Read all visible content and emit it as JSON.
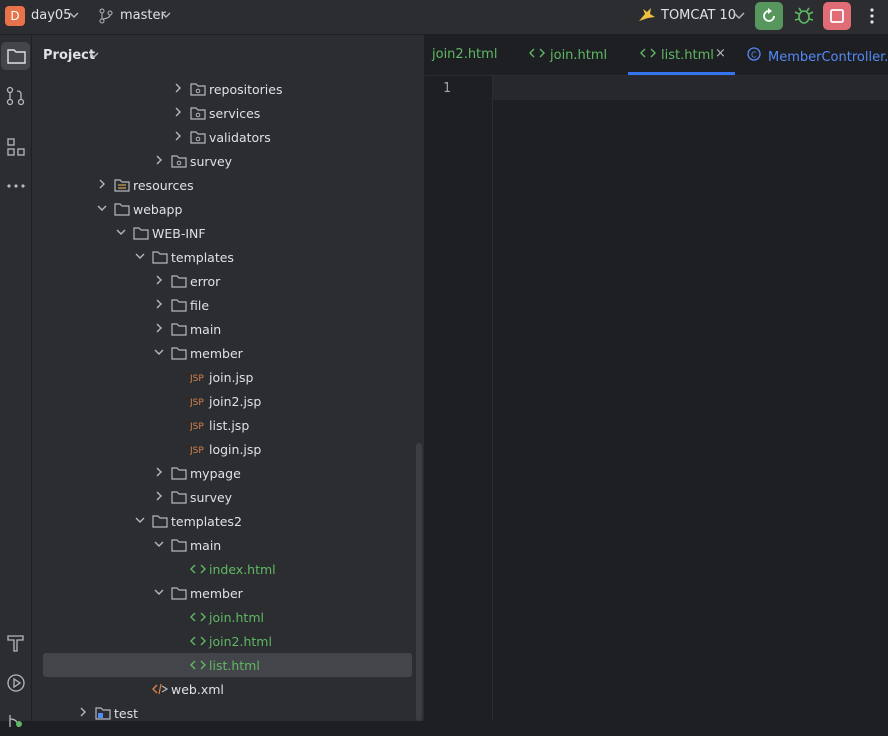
{
  "titlebar": {
    "project_initial": "D",
    "project_name": "day05",
    "branch": "master",
    "run_config": "TOMCAT 10",
    "colors": {
      "badge": "#e8734a",
      "run": "#57965c",
      "stop": "#e06c75"
    }
  },
  "toolstrip": {
    "items": [
      "folder-icon",
      "git-commit-icon",
      "structure-icon",
      "more-icon",
      "build-icon",
      "services-icon"
    ]
  },
  "project": {
    "title": "Project",
    "tree": [
      {
        "label": "repositories",
        "type": "package",
        "depth": 7,
        "expand": "collapsed"
      },
      {
        "label": "services",
        "type": "package",
        "depth": 7,
        "expand": "collapsed"
      },
      {
        "label": "validators",
        "type": "package",
        "depth": 7,
        "expand": "collapsed"
      },
      {
        "label": "survey",
        "type": "package",
        "depth": 6,
        "expand": "collapsed"
      },
      {
        "label": "resources",
        "type": "resources",
        "depth": 3,
        "expand": "collapsed"
      },
      {
        "label": "webapp",
        "type": "folder",
        "depth": 3,
        "expand": "expanded"
      },
      {
        "label": "WEB-INF",
        "type": "folder",
        "depth": 4,
        "expand": "expanded"
      },
      {
        "label": "templates",
        "type": "folder",
        "depth": 5,
        "expand": "expanded"
      },
      {
        "label": "error",
        "type": "folder",
        "depth": 6,
        "expand": "collapsed"
      },
      {
        "label": "file",
        "type": "folder",
        "depth": 6,
        "expand": "collapsed"
      },
      {
        "label": "main",
        "type": "folder",
        "depth": 6,
        "expand": "collapsed"
      },
      {
        "label": "member",
        "type": "folder",
        "depth": 6,
        "expand": "expanded"
      },
      {
        "label": "join.jsp",
        "type": "jsp",
        "depth": 7,
        "expand": "none"
      },
      {
        "label": "join2.jsp",
        "type": "jsp",
        "depth": 7,
        "expand": "none"
      },
      {
        "label": "list.jsp",
        "type": "jsp",
        "depth": 7,
        "expand": "none"
      },
      {
        "label": "login.jsp",
        "type": "jsp",
        "depth": 7,
        "expand": "none"
      },
      {
        "label": "mypage",
        "type": "folder",
        "depth": 6,
        "expand": "collapsed"
      },
      {
        "label": "survey",
        "type": "folder",
        "depth": 6,
        "expand": "collapsed"
      },
      {
        "label": "templates2",
        "type": "folder",
        "depth": 5,
        "expand": "expanded"
      },
      {
        "label": "main",
        "type": "folder",
        "depth": 6,
        "expand": "expanded"
      },
      {
        "label": "index.html",
        "type": "html",
        "depth": 7,
        "expand": "none"
      },
      {
        "label": "member",
        "type": "folder",
        "depth": 6,
        "expand": "expanded"
      },
      {
        "label": "join.html",
        "type": "html",
        "depth": 7,
        "expand": "none"
      },
      {
        "label": "join2.html",
        "type": "html",
        "depth": 7,
        "expand": "none"
      },
      {
        "label": "list.html",
        "type": "html",
        "depth": 7,
        "expand": "none",
        "selected": true
      },
      {
        "label": "web.xml",
        "type": "xml",
        "depth": 5,
        "expand": "none"
      },
      {
        "label": "test",
        "type": "test-folder",
        "depth": 2,
        "expand": "collapsed"
      }
    ]
  },
  "editor": {
    "tabs": [
      {
        "label": "join2.html",
        "icon": "none",
        "active": false,
        "color": "#5fb865"
      },
      {
        "label": "join.html",
        "icon": "html",
        "active": false,
        "color": "#5fb865"
      },
      {
        "label": "list.html",
        "icon": "html",
        "active": true,
        "color": "#5fb865"
      },
      {
        "label": "MemberController.java",
        "icon": "class",
        "active": false,
        "color": "#548af7"
      }
    ],
    "close_glyph": "×",
    "line_numbers": [
      "1"
    ]
  }
}
